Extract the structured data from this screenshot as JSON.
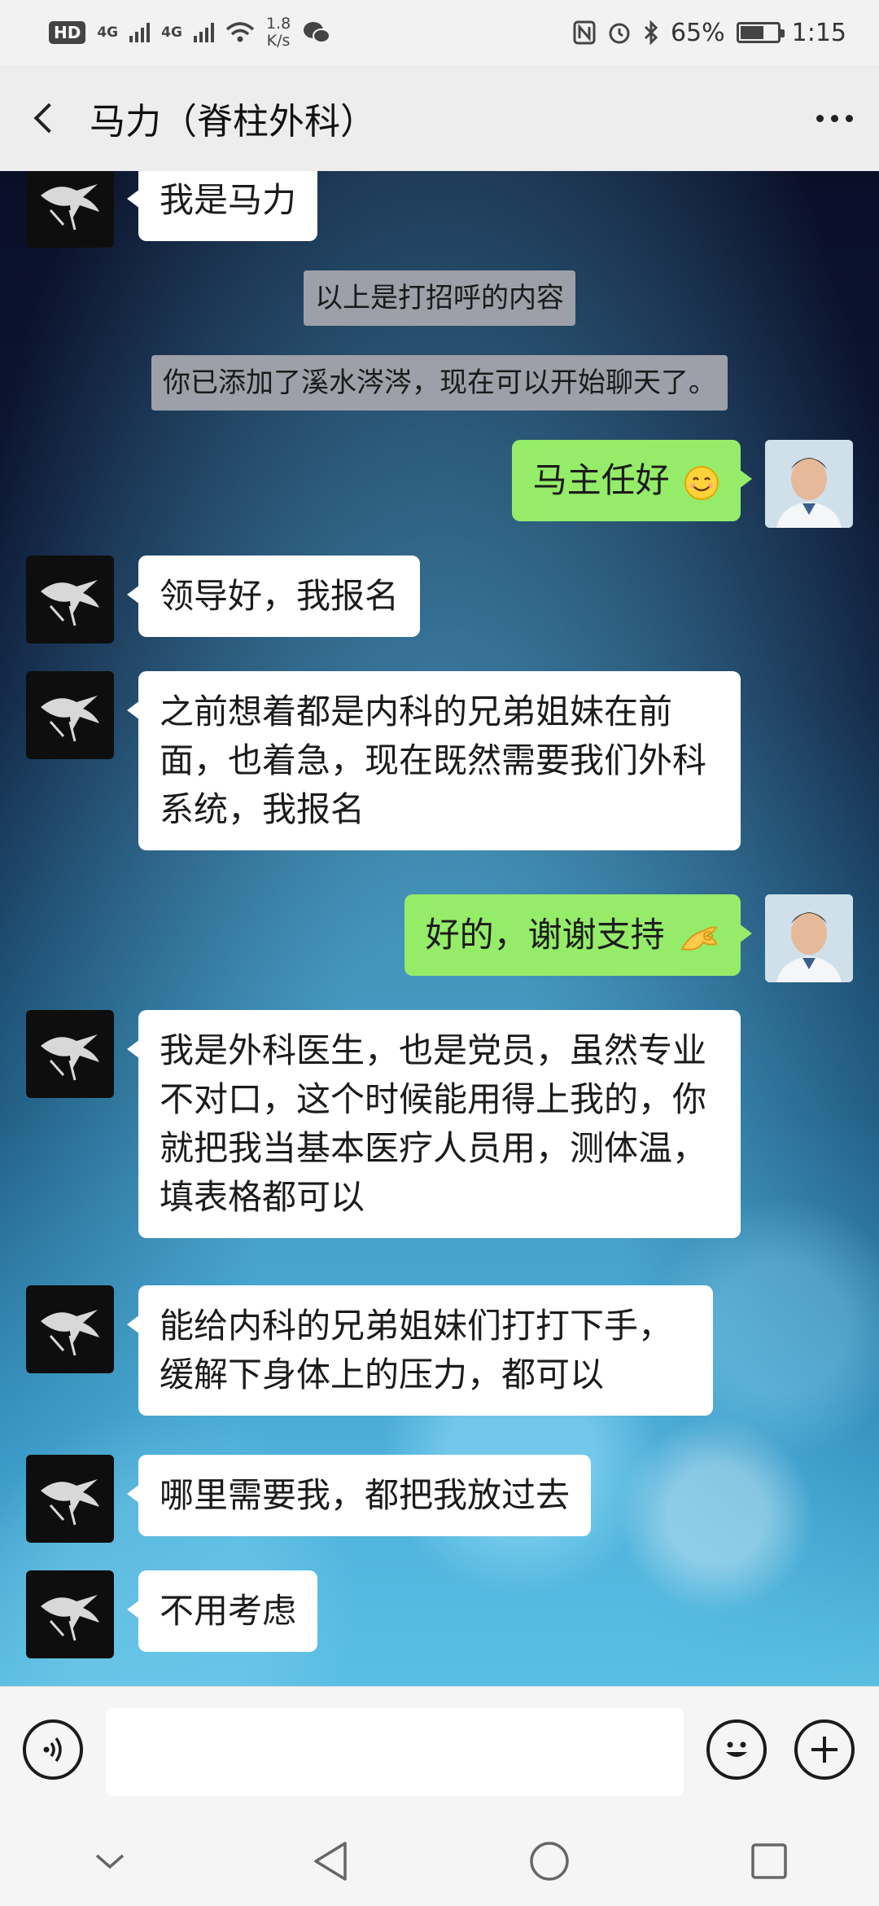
{
  "status_bar": {
    "hd": "HD",
    "net1": "4G",
    "net2": "4G",
    "speed_value": "1.8",
    "speed_unit": "K/s",
    "battery": "65%",
    "battery_level": 0.65,
    "time": "1:15",
    "icons": [
      "nfc-icon",
      "alarm-icon",
      "bluetooth-icon",
      "wechat-icon",
      "wifi-icon"
    ]
  },
  "header": {
    "title": "马力（脊柱外科）",
    "back_icon": "chevron-left-icon",
    "more_icon": "more-dots-icon"
  },
  "messages": [
    {
      "side": "left",
      "text": "我是马力"
    },
    {
      "system": "以上是打招呼的内容"
    },
    {
      "system": "你已添加了溪水涔涔，现在可以开始聊天了。"
    },
    {
      "side": "right",
      "text": "马主任好",
      "emoji": "smile-emoji"
    },
    {
      "side": "left",
      "text": "领导好，我报名"
    },
    {
      "side": "left",
      "text": "之前想着都是内科的兄弟姐妹在前面，也着急，现在既然需要我们外科系统，我报名"
    },
    {
      "side": "right",
      "text": "好的，谢谢支持",
      "emoji": "ok-hand-emoji"
    },
    {
      "side": "left",
      "text": "我是外科医生，也是党员，虽然专业不对口，这个时候能用得上我的，你就把我当基本医疗人员用，测体温，填表格都可以"
    },
    {
      "side": "left",
      "text": "能给内科的兄弟姐妹们打打下手，缓解下身体上的压力，都可以"
    },
    {
      "side": "left",
      "text": "哪里需要我，都把我放过去"
    },
    {
      "side": "left",
      "text": "不用考虑"
    }
  ],
  "input_bar": {
    "voice_icon": "voice-icon",
    "emoji_icon": "emoji-icon",
    "plus_icon": "plus-icon",
    "placeholder": ""
  },
  "nav_bar": {
    "icons": [
      "collapse-icon",
      "back-triangle-icon",
      "home-circle-icon",
      "recents-square-icon"
    ]
  },
  "colors": {
    "bubble_self": "#95ec69",
    "bubble_other": "#ffffff",
    "header_bg": "#ededed"
  }
}
